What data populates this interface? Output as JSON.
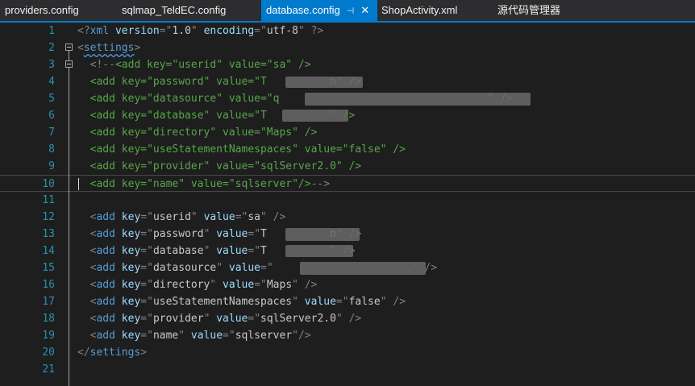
{
  "tabs": [
    {
      "label": "providers.config",
      "active": false
    },
    {
      "label": "sqlmap_TeldEC.config",
      "active": false
    },
    {
      "label": "database.config",
      "active": true,
      "pin_icon": "pin-icon",
      "close_icon": "close-icon"
    },
    {
      "label": "ShopActivity.xml",
      "active": false
    },
    {
      "label": "源代码管理器",
      "active": false
    }
  ],
  "colors": {
    "accent": "#007acc",
    "tag": "#569cd6",
    "attribute": "#9cdcfe",
    "comment": "#57a64a",
    "line_number": "#2b91af",
    "background": "#1e1e1e"
  },
  "editor": {
    "current_line": 10,
    "lines": [
      {
        "n": "1",
        "text": "<?xml version=\"1.0\" encoding=\"utf-8\" ?>"
      },
      {
        "n": "2",
        "text": "<settings>"
      },
      {
        "n": "3",
        "text": "  <!--<add key=\"userid\" value=\"sa\" />"
      },
      {
        "n": "4",
        "text": "  <add key=\"password\" value=\"T          n\" />"
      },
      {
        "n": "5",
        "text": "  <add key=\"datasource\" value=\"q                                 \" />"
      },
      {
        "n": "6",
        "text": "  <add key=\"database\" value=\"T          \" />"
      },
      {
        "n": "7",
        "text": "  <add key=\"directory\" value=\"Maps\" />"
      },
      {
        "n": "8",
        "text": "  <add key=\"useStatementNamespaces\" value=\"false\" />"
      },
      {
        "n": "9",
        "text": "  <add key=\"provider\" value=\"sqlServer2.0\" />"
      },
      {
        "n": "10",
        "text": "  <add key=\"name\" value=\"sqlserver\"/>-->"
      },
      {
        "n": "11",
        "text": ""
      },
      {
        "n": "12",
        "text": "  <add key=\"userid\" value=\"sa\" />"
      },
      {
        "n": "13",
        "text": "  <add key=\"password\" value=\"T          n\" />"
      },
      {
        "n": "14",
        "text": "  <add key=\"database\" value=\"T          \" />"
      },
      {
        "n": "15",
        "text": "  <add key=\"datasource\" value=\"                      \" />"
      },
      {
        "n": "16",
        "text": "  <add key=\"directory\" value=\"Maps\" />"
      },
      {
        "n": "17",
        "text": "  <add key=\"useStatementNamespaces\" value=\"false\" />"
      },
      {
        "n": "18",
        "text": "  <add key=\"provider\" value=\"sqlServer2.0\" />"
      },
      {
        "n": "19",
        "text": "  <add key=\"name\" value=\"sqlserver\"/>"
      },
      {
        "n": "20",
        "text": "</settings>"
      },
      {
        "n": "21",
        "text": ""
      }
    ]
  }
}
